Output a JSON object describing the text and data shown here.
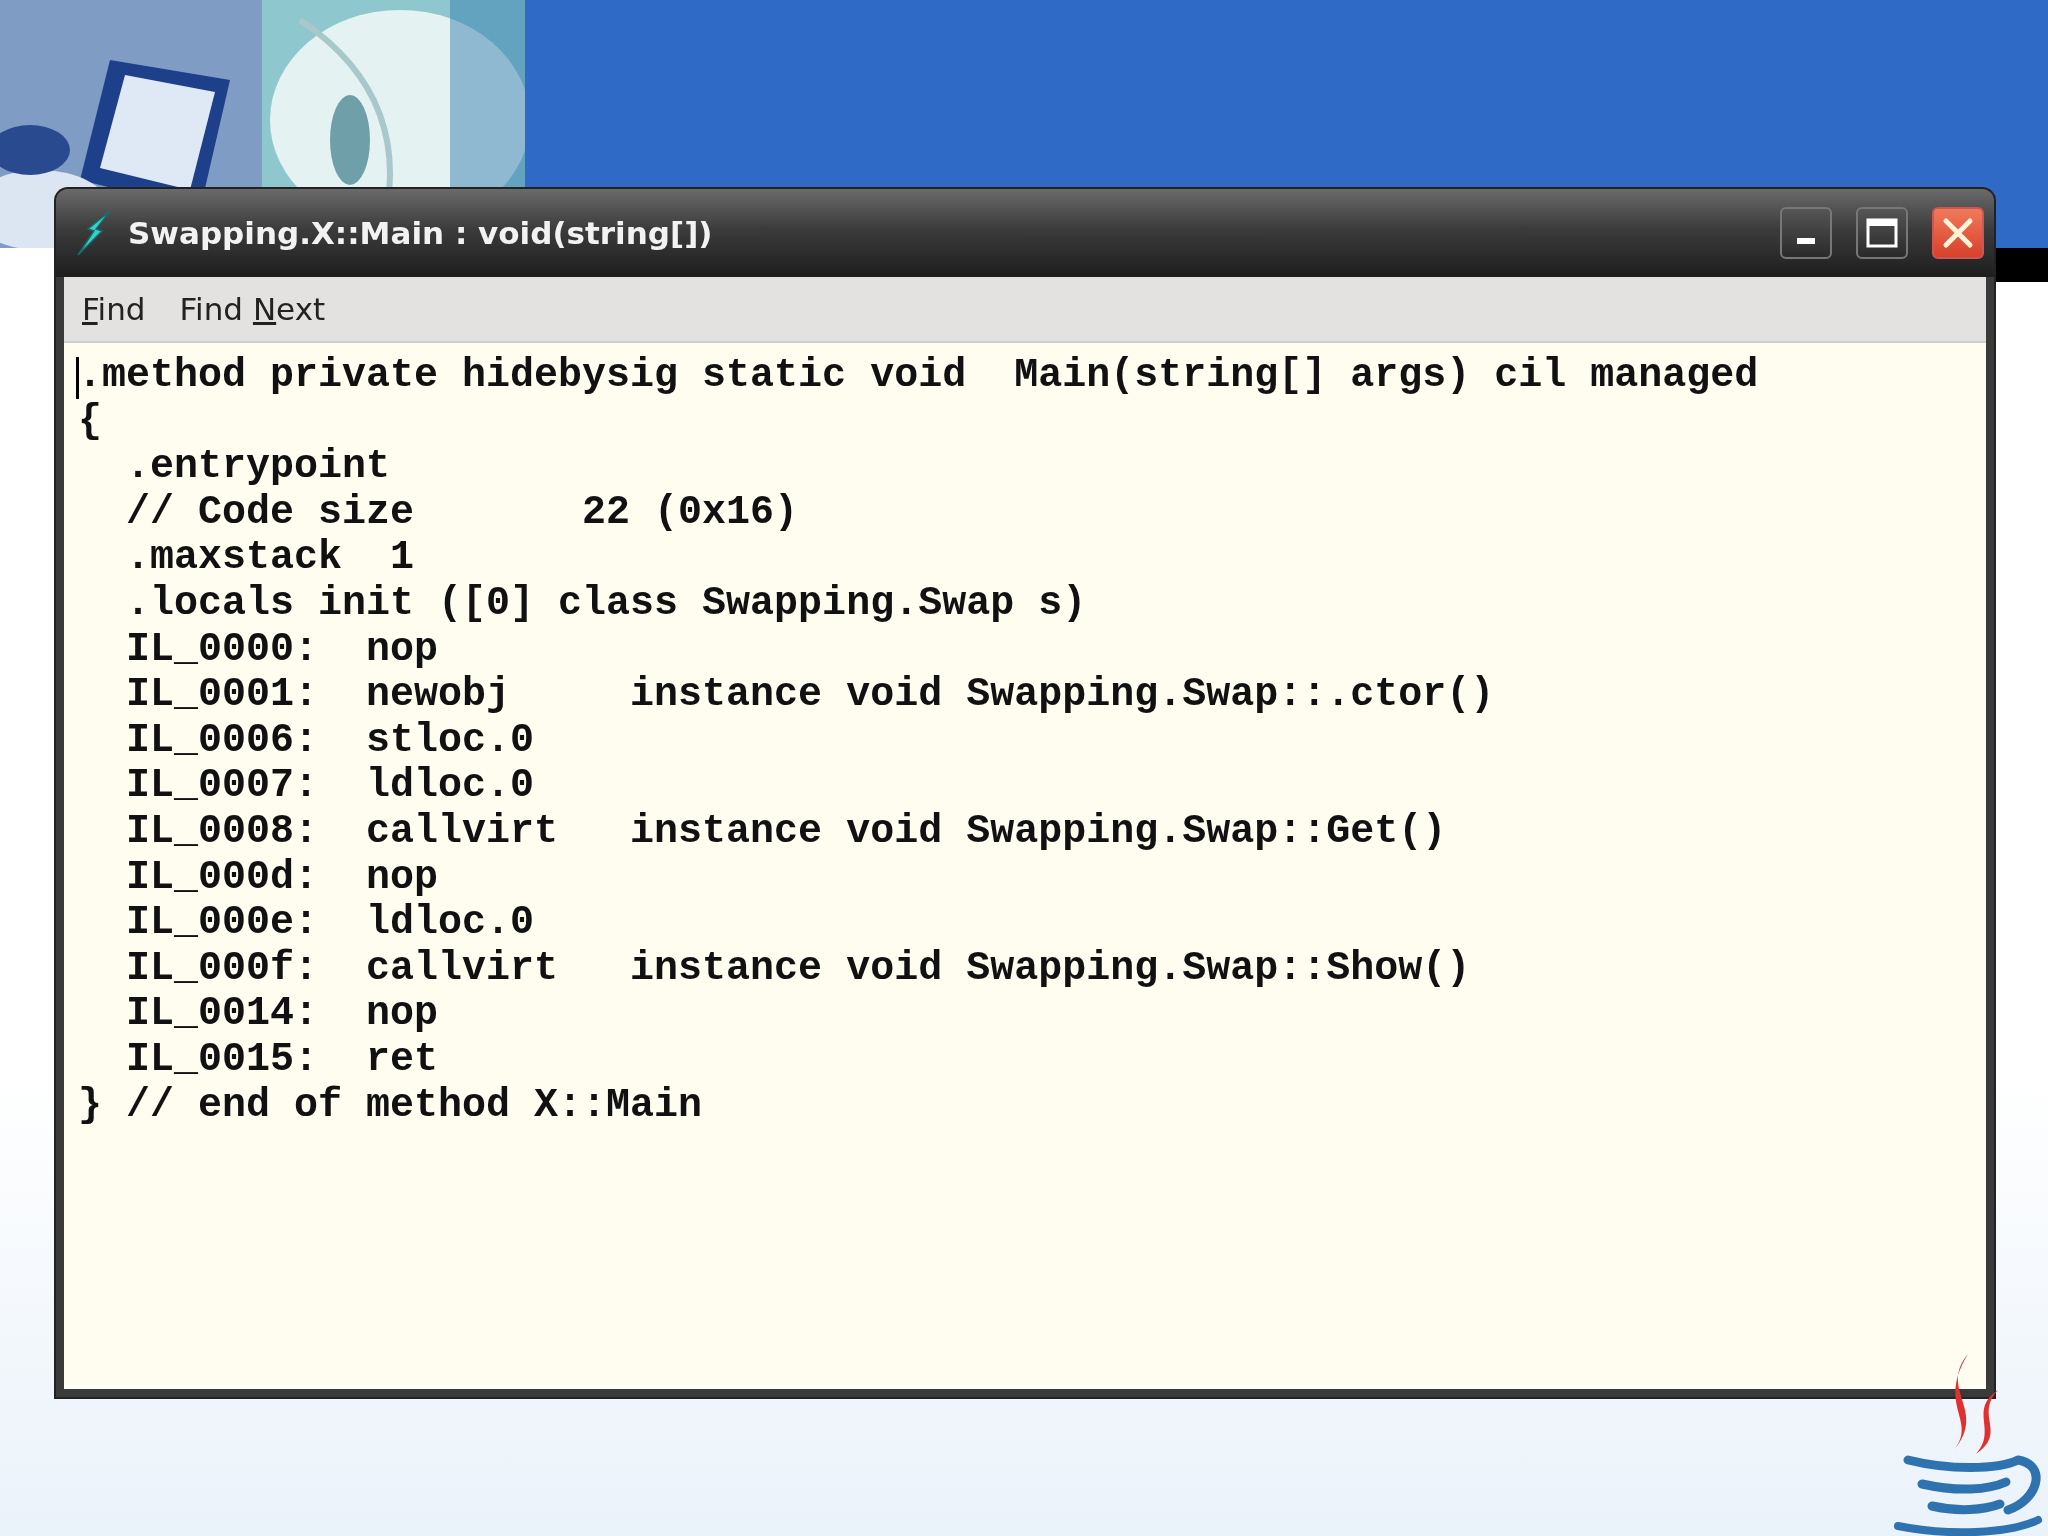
{
  "window": {
    "title": "Swapping.X::Main : void(string[])"
  },
  "menu": [
    {
      "mnemonic": "F",
      "label_after": "ind"
    },
    {
      "label_before": "Find ",
      "mnemonic": "N",
      "label_after": "ext"
    }
  ],
  "code_lines": [
    ".method private hidebysig static void  Main(string[] args) cil managed",
    "{",
    "  .entrypoint",
    "  // Code size       22 (0x16)",
    "  .maxstack  1",
    "  .locals init ([0] class Swapping.Swap s)",
    "  IL_0000:  nop",
    "  IL_0001:  newobj     instance void Swapping.Swap::.ctor()",
    "  IL_0006:  stloc.0",
    "  IL_0007:  ldloc.0",
    "  IL_0008:  callvirt   instance void Swapping.Swap::Get()",
    "  IL_000d:  nop",
    "  IL_000e:  ldloc.0",
    "  IL_000f:  callvirt   instance void Swapping.Swap::Show()",
    "  IL_0014:  nop",
    "  IL_0015:  ret",
    "} // end of method X::Main"
  ]
}
